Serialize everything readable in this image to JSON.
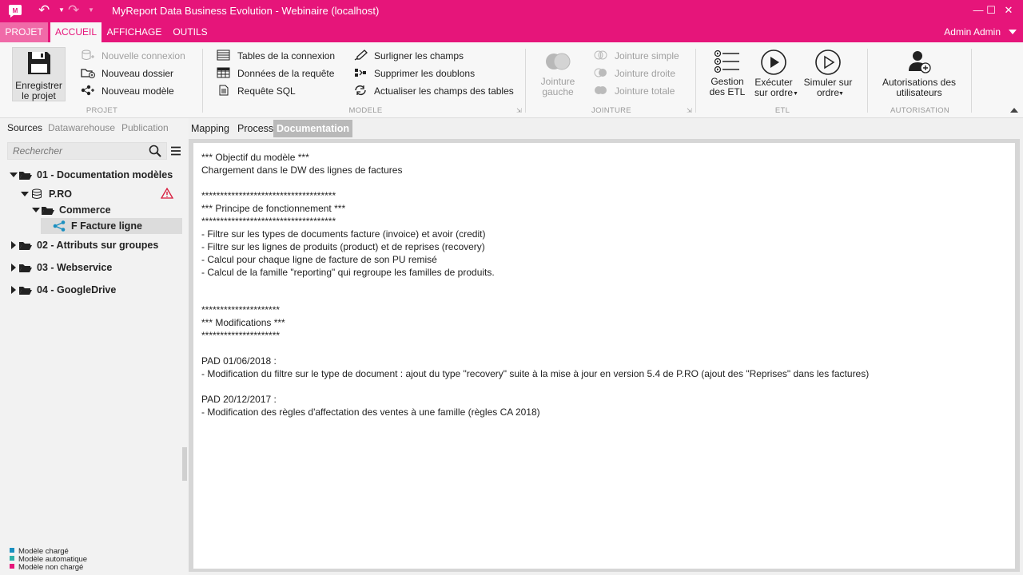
{
  "window": {
    "title": "MyReport Data Business Evolution - Webinaire (localhost)",
    "controls": {
      "minimize": "—",
      "maximize": "☐",
      "close": "✕"
    }
  },
  "menu": {
    "tabs": [
      "PROJET",
      "ACCUEIL",
      "AFFICHAGE",
      "OUTILS"
    ],
    "user": "Admin Admin"
  },
  "ribbon": {
    "projet": {
      "save_label": "Enregistrer\nle projet",
      "new_connection": "Nouvelle connexion",
      "new_folder": "Nouveau dossier",
      "new_model": "Nouveau modèle",
      "group": "PROJET"
    },
    "modele": {
      "tables_connection": "Tables de la connexion",
      "query_data": "Données de la requête",
      "sql_query": "Requête SQL",
      "highlight_fields": "Surligner les champs",
      "remove_duplicates": "Supprimer les doublons",
      "refresh_fields": "Actualiser les champs des tables",
      "group": "MODELE"
    },
    "jointure": {
      "left_join": "Jointure\ngauche",
      "simple_join": "Jointure simple",
      "right_join": "Jointure droite",
      "full_join": "Jointure totale",
      "group": "JOINTURE"
    },
    "etl": {
      "manage": "Gestion\ndes ETL",
      "run": "Exécuter\nsur ordre",
      "simulate": "Simuler sur\nordre",
      "group": "ETL"
    },
    "autorisation": {
      "user_perms": "Autorisations des\nutilisateurs",
      "group": "AUTORISATION"
    }
  },
  "sidebar": {
    "tabs": [
      "Sources",
      "Datawarehouse",
      "Publication"
    ],
    "search_placeholder": "Rechercher",
    "tree": {
      "f01": "01 - Documentation modèles",
      "pro": "P.RO",
      "commerce": "Commerce",
      "facture": "F Facture ligne",
      "f02": "02 - Attributs sur groupes",
      "f03": "03 - Webservice",
      "f04": "04 - GoogleDrive"
    },
    "legend": [
      {
        "label": "Modèle chargé",
        "color": "#1a8fc0"
      },
      {
        "label": "Modèle automatique",
        "color": "#2fb0a8"
      },
      {
        "label": "Modèle non chargé",
        "color": "#e6157a"
      }
    ]
  },
  "content": {
    "tabs": [
      "Mapping",
      "Process",
      "Documentation"
    ],
    "doc_lines": [
      "*** Objectif du modèle ***",
      "Chargement dans le DW des lignes de factures",
      "************************************",
      "*** Principe de fonctionnement ***",
      "************************************",
      "- Filtre sur les types de documents facture (invoice) et avoir (credit)",
      "- Filtre sur les lignes de produits (product) et de reprises (recovery)",
      "- Calcul pour chaque ligne de facture de son PU remisé",
      "- Calcul de la famille \"reporting\" qui regroupe les familles de produits.",
      "*********************",
      "*** Modifications ***",
      "*********************",
      "PAD 01/06/2018 :",
      "- Modification du filtre sur le type de document : ajout du type \"recovery\" suite à la mise à jour en version 5.4 de P.RO (ajout des \"Reprises\" dans les factures)",
      "PAD 20/12/2017 :",
      "- Modification des règles d'affectation des ventes à une famille (règles CA 2018)"
    ]
  }
}
